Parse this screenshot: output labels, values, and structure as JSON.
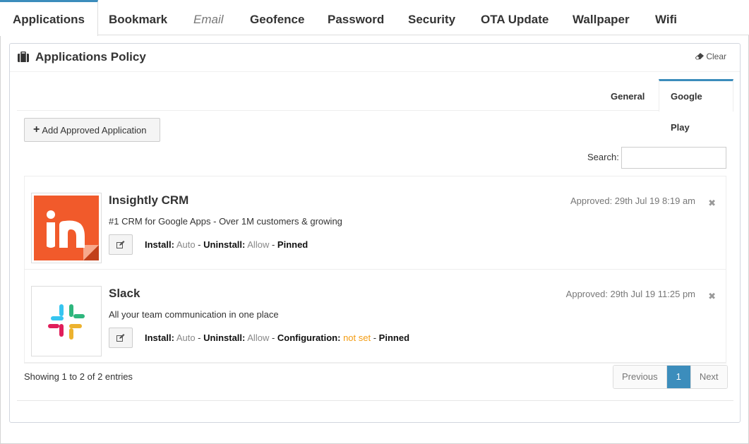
{
  "top_tabs": [
    {
      "label": "Applications"
    },
    {
      "label": "Bookmark"
    },
    {
      "label": "Email"
    },
    {
      "label": "Geofence"
    },
    {
      "label": "Password"
    },
    {
      "label": "Security"
    },
    {
      "label": "OTA Update"
    },
    {
      "label": "Wallpaper"
    },
    {
      "label": "Wifi"
    }
  ],
  "panel": {
    "title": "Applications Policy",
    "clear_label": "Clear"
  },
  "subtabs": [
    {
      "label": "General"
    },
    {
      "label": "Google Play"
    }
  ],
  "add_button_label": "Add Approved Application",
  "search": {
    "label": "Search:",
    "value": ""
  },
  "apps": [
    {
      "name": "Insightly CRM",
      "description": "#1 CRM for Google Apps - Over 1M customers & growing",
      "approved": "Approved: 29th Jul 19 8:19 am",
      "install_label": "Install:",
      "install_value": "Auto",
      "uninstall_label": "Uninstall:",
      "uninstall_value": "Allow",
      "pinned": "Pinned"
    },
    {
      "name": "Slack",
      "description": "All your team communication in one place",
      "approved": "Approved: 29th Jul 19 11:25 pm",
      "install_label": "Install:",
      "install_value": "Auto",
      "uninstall_label": "Uninstall:",
      "uninstall_value": "Allow",
      "config_label": "Configuration:",
      "config_value": "not set",
      "pinned": "Pinned"
    }
  ],
  "footer": {
    "showing": "Showing 1 to 2 of 2 entries",
    "prev": "Previous",
    "page": "1",
    "next": "Next"
  },
  "colors": {
    "accent": "#3c8dbc",
    "warning": "#f39c12",
    "insightly": "#f15a2b"
  }
}
